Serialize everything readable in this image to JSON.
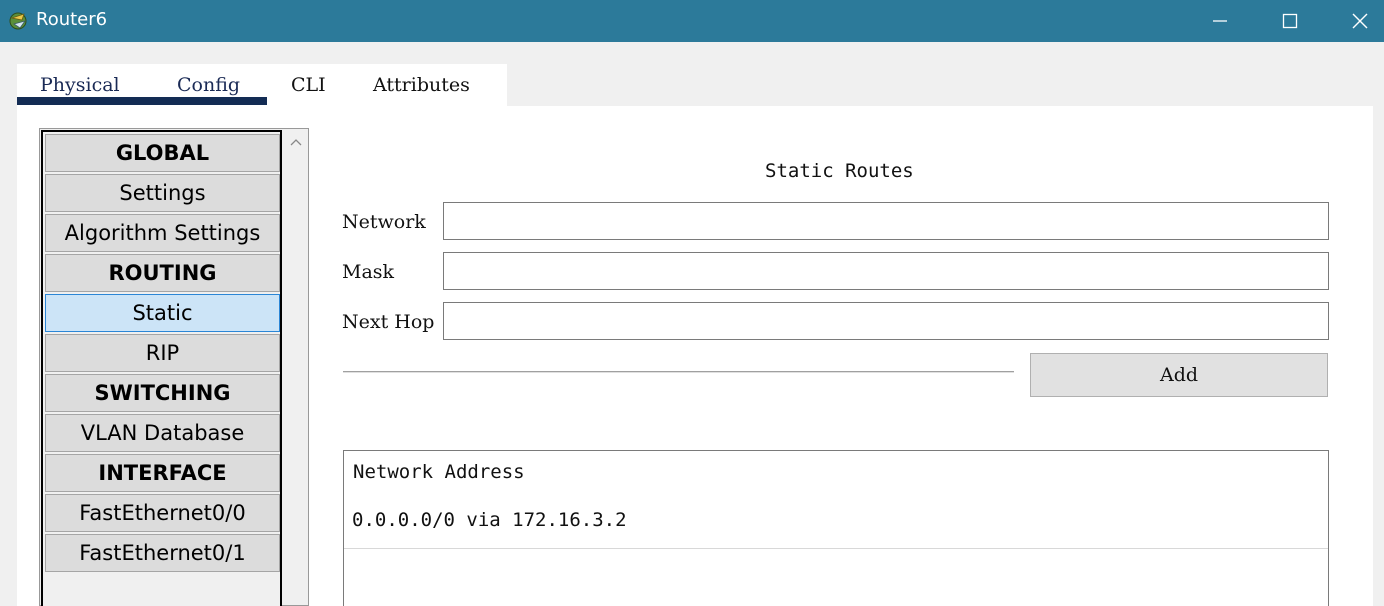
{
  "window": {
    "title": "Router6",
    "controls": {
      "minimize": "minimize-icon",
      "maximize": "maximize-icon",
      "close": "close-icon"
    },
    "titlebar_color": "#2c7a9a"
  },
  "tabs": [
    {
      "label": "Physical"
    },
    {
      "label": "Config"
    },
    {
      "label": "CLI"
    },
    {
      "label": "Attributes"
    }
  ],
  "active_tab": "Config",
  "sidebar": {
    "items": [
      {
        "label": "GLOBAL",
        "type": "header"
      },
      {
        "label": "Settings",
        "type": "item"
      },
      {
        "label": "Algorithm Settings",
        "type": "item"
      },
      {
        "label": "ROUTING",
        "type": "header"
      },
      {
        "label": "Static",
        "type": "item",
        "selected": true
      },
      {
        "label": "RIP",
        "type": "item"
      },
      {
        "label": "SWITCHING",
        "type": "header"
      },
      {
        "label": "VLAN Database",
        "type": "item"
      },
      {
        "label": "INTERFACE",
        "type": "header"
      },
      {
        "label": "FastEthernet0/0",
        "type": "item"
      },
      {
        "label": "FastEthernet0/1",
        "type": "item"
      }
    ],
    "selected_color": "#cce4f7"
  },
  "static_routes": {
    "title": "Static Routes",
    "fields": {
      "network_label": "Network",
      "network_value": "",
      "mask_label": "Mask",
      "mask_value": "",
      "next_hop_label": "Next Hop",
      "next_hop_value": ""
    },
    "add_label": "Add",
    "table": {
      "header": "Network Address",
      "rows": [
        "0.0.0.0/0 via 172.16.3.2"
      ]
    }
  }
}
